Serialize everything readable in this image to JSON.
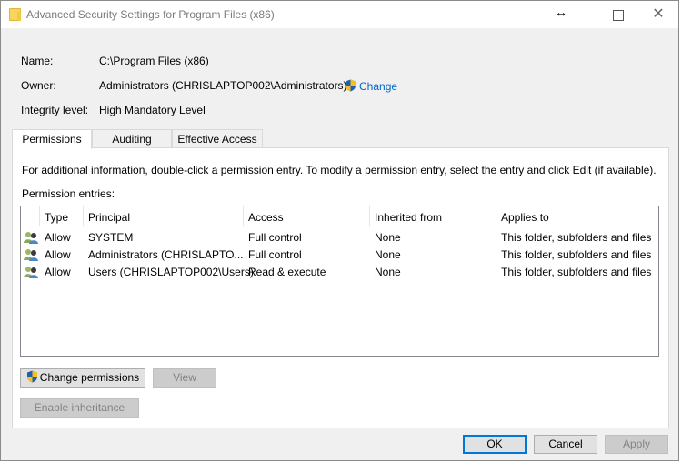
{
  "window": {
    "title": "Advanced Security Settings for Program Files (x86)",
    "resize_cursor": "↔",
    "close_glyph": "✕"
  },
  "info": {
    "name_label": "Name:",
    "name_value": "C:\\Program Files (x86)",
    "owner_label": "Owner:",
    "owner_value": "Administrators (CHRISLAPTOP002\\Administrators)",
    "change_link": "Change",
    "integrity_label": "Integrity level:",
    "integrity_value": "High Mandatory Level"
  },
  "tabs": [
    {
      "label": "Permissions",
      "active": true
    },
    {
      "label": "Auditing",
      "active": false
    },
    {
      "label": "Effective Access",
      "active": false
    }
  ],
  "permissions": {
    "hint": "For additional information, double-click a permission entry. To modify a permission entry, select the entry and click Edit (if available).",
    "entries_label": "Permission entries:",
    "columns": [
      "Type",
      "Principal",
      "Access",
      "Inherited from",
      "Applies to"
    ],
    "rows": [
      {
        "type": "Allow",
        "principal": "SYSTEM",
        "access": "Full control",
        "inherited_from": "None",
        "applies_to": "This folder, subfolders and files"
      },
      {
        "type": "Allow",
        "principal": "Administrators (CHRISLAPTO...",
        "access": "Full control",
        "inherited_from": "None",
        "applies_to": "This folder, subfolders and files"
      },
      {
        "type": "Allow",
        "principal": "Users (CHRISLAPTOP002\\Users)",
        "access": "Read & execute",
        "inherited_from": "None",
        "applies_to": "This folder, subfolders and files"
      }
    ],
    "change_permissions_button": "Change permissions",
    "view_button": "View",
    "enable_inheritance_button": "Enable inheritance"
  },
  "footer": {
    "ok": "OK",
    "cancel": "Cancel",
    "apply": "Apply"
  },
  "colors": {
    "link": "#0066cc",
    "default_button_border": "#0078d7"
  }
}
